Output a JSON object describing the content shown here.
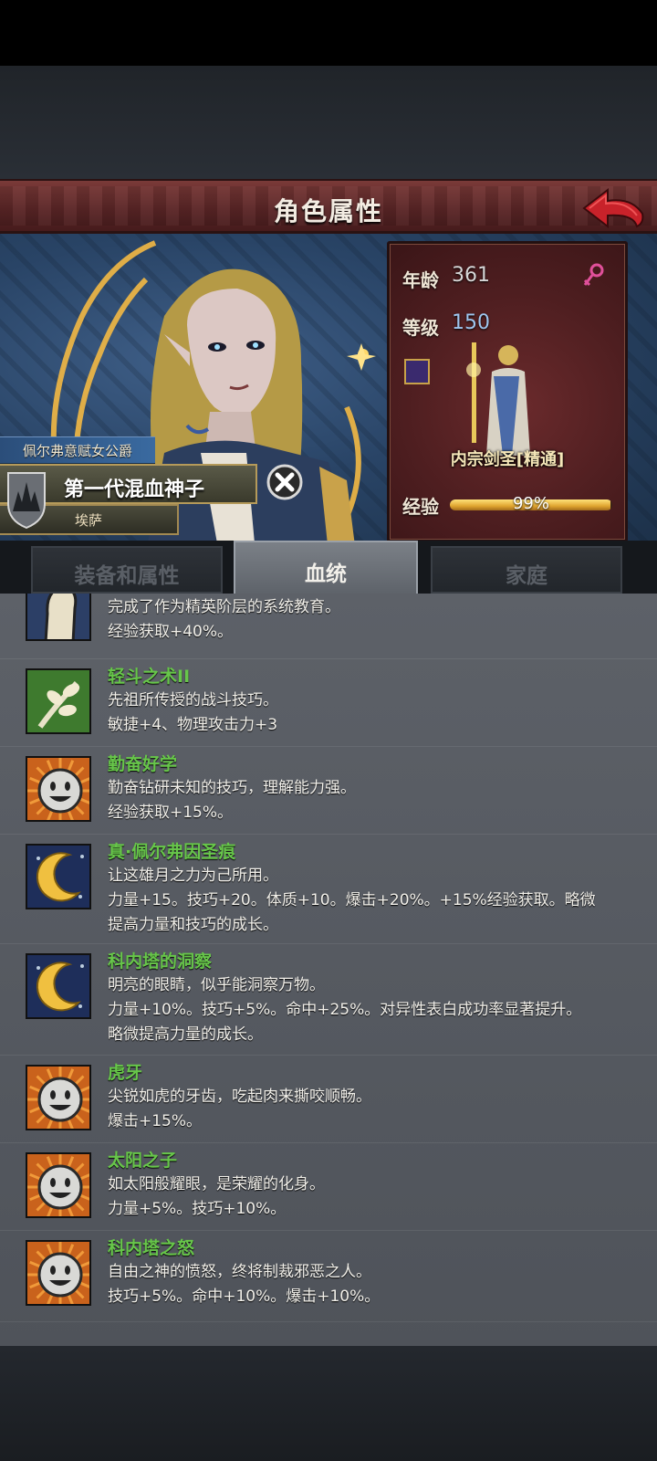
{
  "header": {
    "title": "角色属性",
    "back_icon": "back-arrow-icon"
  },
  "character": {
    "title_tag": "佩尔弗意赋女公爵",
    "name": "第一代混血神子",
    "sub_name": "埃萨"
  },
  "stats": {
    "age_label": "年龄",
    "age_value": "361",
    "level_label": "等级",
    "level_value": "150",
    "class_name": "内宗剑圣[精通]",
    "exp_label": "经验",
    "exp_percent_text": "99%",
    "exp_fraction": 0.99,
    "gender_icon": "female-icon"
  },
  "tabs": [
    {
      "label": "装备和属性",
      "active": false
    },
    {
      "label": "血统",
      "active": true
    },
    {
      "label": "家庭",
      "active": false
    }
  ],
  "traits": [
    {
      "name": "",
      "icon": "arm-icon",
      "lines": [
        "完成了作为精英阶层的系统教育。",
        "经验获取+40%。"
      ]
    },
    {
      "name": "轻斗之术II",
      "icon": "branch-icon",
      "lines": [
        "先祖所传授的战斗技巧。",
        "敏捷+4、物理攻击力+3"
      ]
    },
    {
      "name": "勤奋好学",
      "icon": "smile-icon",
      "lines": [
        "勤奋钻研未知的技巧，理解能力强。",
        "经验获取+15%。"
      ]
    },
    {
      "name": "真·佩尔弗因圣痕",
      "icon": "moon-icon",
      "lines": [
        "让这雄月之力为己所用。",
        "力量+15。技巧+20。体质+10。爆击+20%。+15%经验获取。略微",
        "提高力量和技巧的成长。"
      ]
    },
    {
      "name": "科内塔的洞察",
      "icon": "moon-icon",
      "lines": [
        "明亮的眼睛，似乎能洞察万物。",
        "力量+10%。技巧+5%。命中+25%。对异性表白成功率显著提升。",
        "略微提高力量的成长。"
      ]
    },
    {
      "name": "虎牙",
      "icon": "smile-icon",
      "lines": [
        "尖锐如虎的牙齿，吃起肉来撕咬顺畅。",
        "爆击+15%。"
      ]
    },
    {
      "name": "太阳之子",
      "icon": "smile-icon",
      "lines": [
        "如太阳般耀眼，是荣耀的化身。",
        "力量+5%。技巧+10%。"
      ]
    },
    {
      "name": "科内塔之怒",
      "icon": "smile-icon",
      "lines": [
        "自由之神的愤怒，终将制裁邪恶之人。",
        "技巧+5%。命中+10%。爆击+10%。"
      ]
    }
  ]
}
